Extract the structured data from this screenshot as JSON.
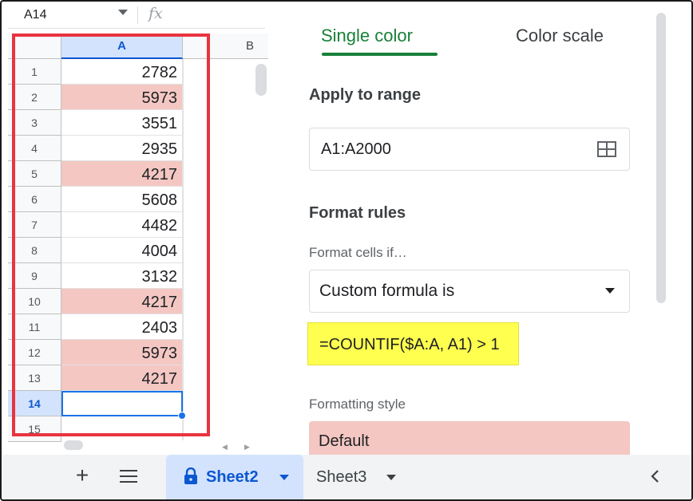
{
  "name_box": {
    "value": "A14"
  },
  "formula_bar": {
    "fx_label": "fx"
  },
  "grid": {
    "columns": [
      "A",
      "B"
    ],
    "rows": [
      {
        "num": "1",
        "value": "2782",
        "duplicate": false
      },
      {
        "num": "2",
        "value": "5973",
        "duplicate": true
      },
      {
        "num": "3",
        "value": "3551",
        "duplicate": false
      },
      {
        "num": "4",
        "value": "2935",
        "duplicate": false
      },
      {
        "num": "5",
        "value": "4217",
        "duplicate": true
      },
      {
        "num": "6",
        "value": "5608",
        "duplicate": false
      },
      {
        "num": "7",
        "value": "4482",
        "duplicate": false
      },
      {
        "num": "8",
        "value": "4004",
        "duplicate": false
      },
      {
        "num": "9",
        "value": "3132",
        "duplicate": false
      },
      {
        "num": "10",
        "value": "4217",
        "duplicate": true
      },
      {
        "num": "11",
        "value": "2403",
        "duplicate": false
      },
      {
        "num": "12",
        "value": "5973",
        "duplicate": true
      },
      {
        "num": "13",
        "value": "4217",
        "duplicate": true
      },
      {
        "num": "14",
        "value": "",
        "duplicate": false
      },
      {
        "num": "15",
        "value": "",
        "duplicate": false
      }
    ],
    "active_row": "14",
    "highlight_color": "#f4c7c3",
    "annotation_color": "#e8343f"
  },
  "panel": {
    "tabs": {
      "single": "Single color",
      "scale": "Color scale"
    },
    "apply_range_label": "Apply to range",
    "range_value": "A1:A2000",
    "format_rules_label": "Format rules",
    "format_cells_if_label": "Format cells if…",
    "condition_value": "Custom formula is",
    "formula_value": "=COUNTIF($A:A, A1) > 1",
    "formula_highlight_color": "#ffff4f",
    "formatting_style_label": "Formatting style",
    "style_value": "Default"
  },
  "sheets": {
    "add_icon": "plus-icon",
    "list_icon": "menu-icon",
    "tabs": [
      "Sheet2",
      "Sheet3"
    ],
    "active": "Sheet2",
    "active_color": "#0b57d0"
  }
}
